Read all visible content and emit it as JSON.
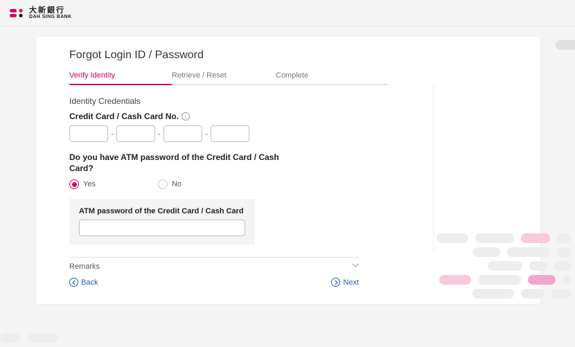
{
  "brand": {
    "cn": "大新銀行",
    "en": "DAH SING BANK"
  },
  "page": {
    "title": "Forgot Login ID / Password",
    "steps": {
      "s1": "Verify Identity",
      "s2": "Retrieve / Reset",
      "s3": "Complete"
    }
  },
  "form": {
    "section_title": "Identity Credentials",
    "cc_label": "Credit Card / Cash Card No.",
    "cc_dash": "-",
    "atm_q": "Do you have ATM password of the Credit Card / Cash Card?",
    "yes": "Yes",
    "no": "No",
    "atm_selected": "yes",
    "pw_title": "ATM password of the Credit Card / Cash Card",
    "remarks_label": "Remarks"
  },
  "nav": {
    "back": "Back",
    "next": "Next"
  },
  "colors": {
    "brand_pink": "#d6006d",
    "link_blue": "#2b5fa7"
  }
}
